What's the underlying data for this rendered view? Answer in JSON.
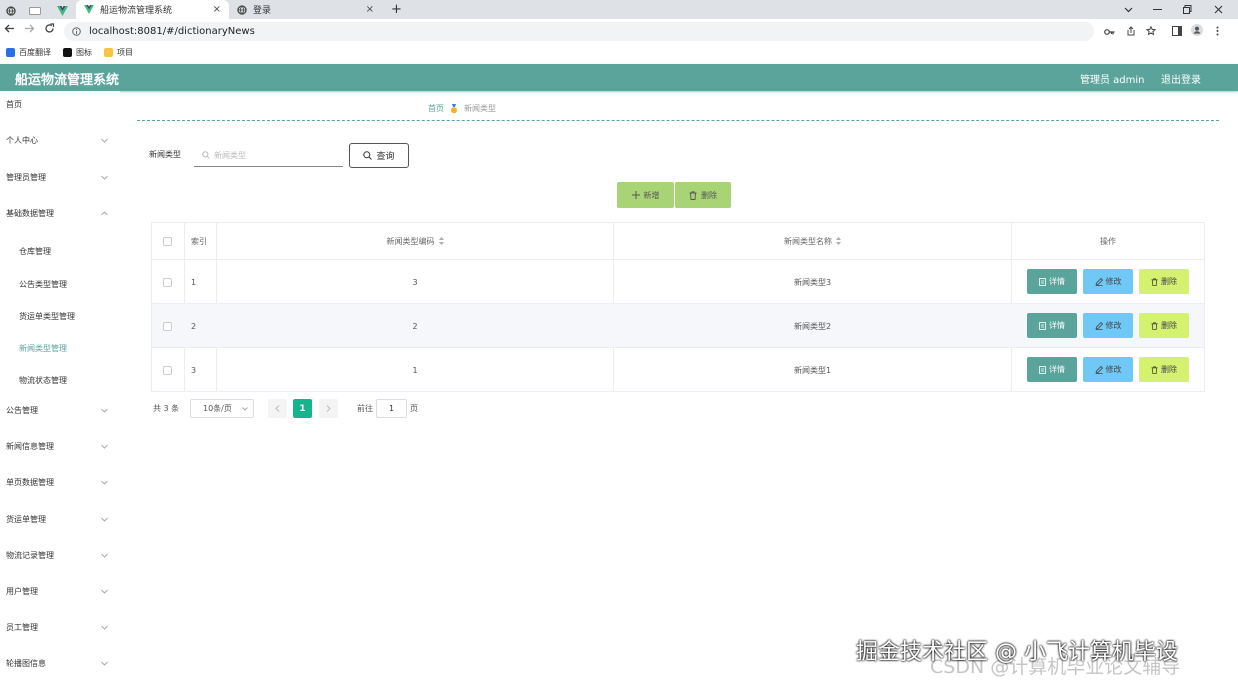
{
  "browser": {
    "tabs": [
      {
        "title": "船运物流管理系统",
        "close": "×"
      },
      {
        "title": "登录",
        "close": "×"
      }
    ],
    "new_tab": "+",
    "url": "localhost:8081/#/dictionaryNews",
    "bookmarks": [
      "百度翻译",
      "图标",
      "项目"
    ]
  },
  "app": {
    "title": "船运物流管理系统",
    "user": "管理员 admin",
    "logout": "退出登录"
  },
  "sidebar": {
    "items": [
      {
        "label": "首页"
      },
      {
        "label": "个人中心"
      },
      {
        "label": "管理员管理"
      },
      {
        "label": "基础数据管理"
      },
      {
        "label": "公告管理"
      },
      {
        "label": "新闻信息管理"
      },
      {
        "label": "单页数据管理"
      },
      {
        "label": "货运单管理"
      },
      {
        "label": "物流记录管理"
      },
      {
        "label": "用户管理"
      },
      {
        "label": "员工管理"
      },
      {
        "label": "轮播图信息"
      }
    ],
    "sub_items": [
      "仓库管理",
      "公告类型管理",
      "货运单类型管理",
      "新闻类型管理",
      "物流状态管理"
    ]
  },
  "breadcrumb": {
    "home": "首页",
    "current": "新闻类型"
  },
  "search": {
    "label": "新闻类型",
    "placeholder": "新闻类型",
    "button": "查询"
  },
  "actions": {
    "add": "新增",
    "delete": "删除"
  },
  "table": {
    "headers": {
      "index": "索引",
      "code": "新闻类型编码",
      "name": "新闻类型名称",
      "ops": "操作"
    },
    "rows": [
      {
        "index": "1",
        "code": "3",
        "name": "新闻类型3"
      },
      {
        "index": "2",
        "code": "2",
        "name": "新闻类型2"
      },
      {
        "index": "3",
        "code": "1",
        "name": "新闻类型1"
      }
    ],
    "row_buttons": {
      "detail": "详情",
      "edit": "修改",
      "delete": "删除"
    }
  },
  "pagination": {
    "total": "共 3 条",
    "page_size": "10条/页",
    "current_page": "1",
    "goto_prefix": "前往",
    "goto_value": "1",
    "goto_suffix": "页"
  },
  "watermark": {
    "line1": "掘金技术社区 @ 小飞计算机毕设",
    "line2": "CSDN @计算机毕业论文辅导"
  },
  "colors": {
    "primary": "#5aa49c",
    "green_btn": "#a9d475",
    "blue_btn": "#70c8f6",
    "lime_btn": "#d4f270",
    "active_page": "#16b48c"
  }
}
